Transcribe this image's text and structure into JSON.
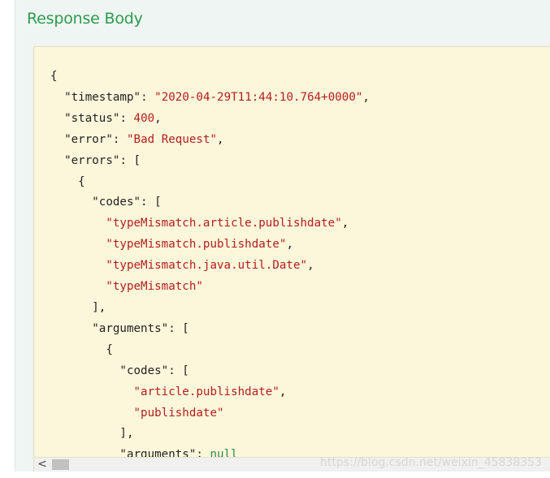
{
  "section": {
    "title": "Response Body"
  },
  "response": {
    "timestamp_key": "\"timestamp\"",
    "timestamp_val": "\"2020-04-29T11:44:10.764+0000\"",
    "status_key": "\"status\"",
    "status_val": "400",
    "error_key": "\"error\"",
    "error_val": "\"Bad Request\"",
    "errors_key": "\"errors\"",
    "codes_key": "\"codes\"",
    "codes": [
      "\"typeMismatch.article.publishdate\"",
      "\"typeMismatch.publishdate\"",
      "\"typeMismatch.java.util.Date\"",
      "\"typeMismatch\""
    ],
    "arguments_key": "\"arguments\"",
    "arg_codes_key": "\"codes\"",
    "arg_codes": [
      "\"article.publishdate\"",
      "\"publishdate\""
    ],
    "arg_arguments_key": "\"arguments\"",
    "arg_arguments_val": "null"
  },
  "scrollbar": {
    "left_arrow": "<"
  },
  "watermark": "https://blog.csdn.net/weixin_45838353",
  "colors": {
    "title": "#2e9a4f",
    "code_background": "#fcf6db",
    "string": "#b31e1e",
    "keyword": "#2f8a4a"
  }
}
